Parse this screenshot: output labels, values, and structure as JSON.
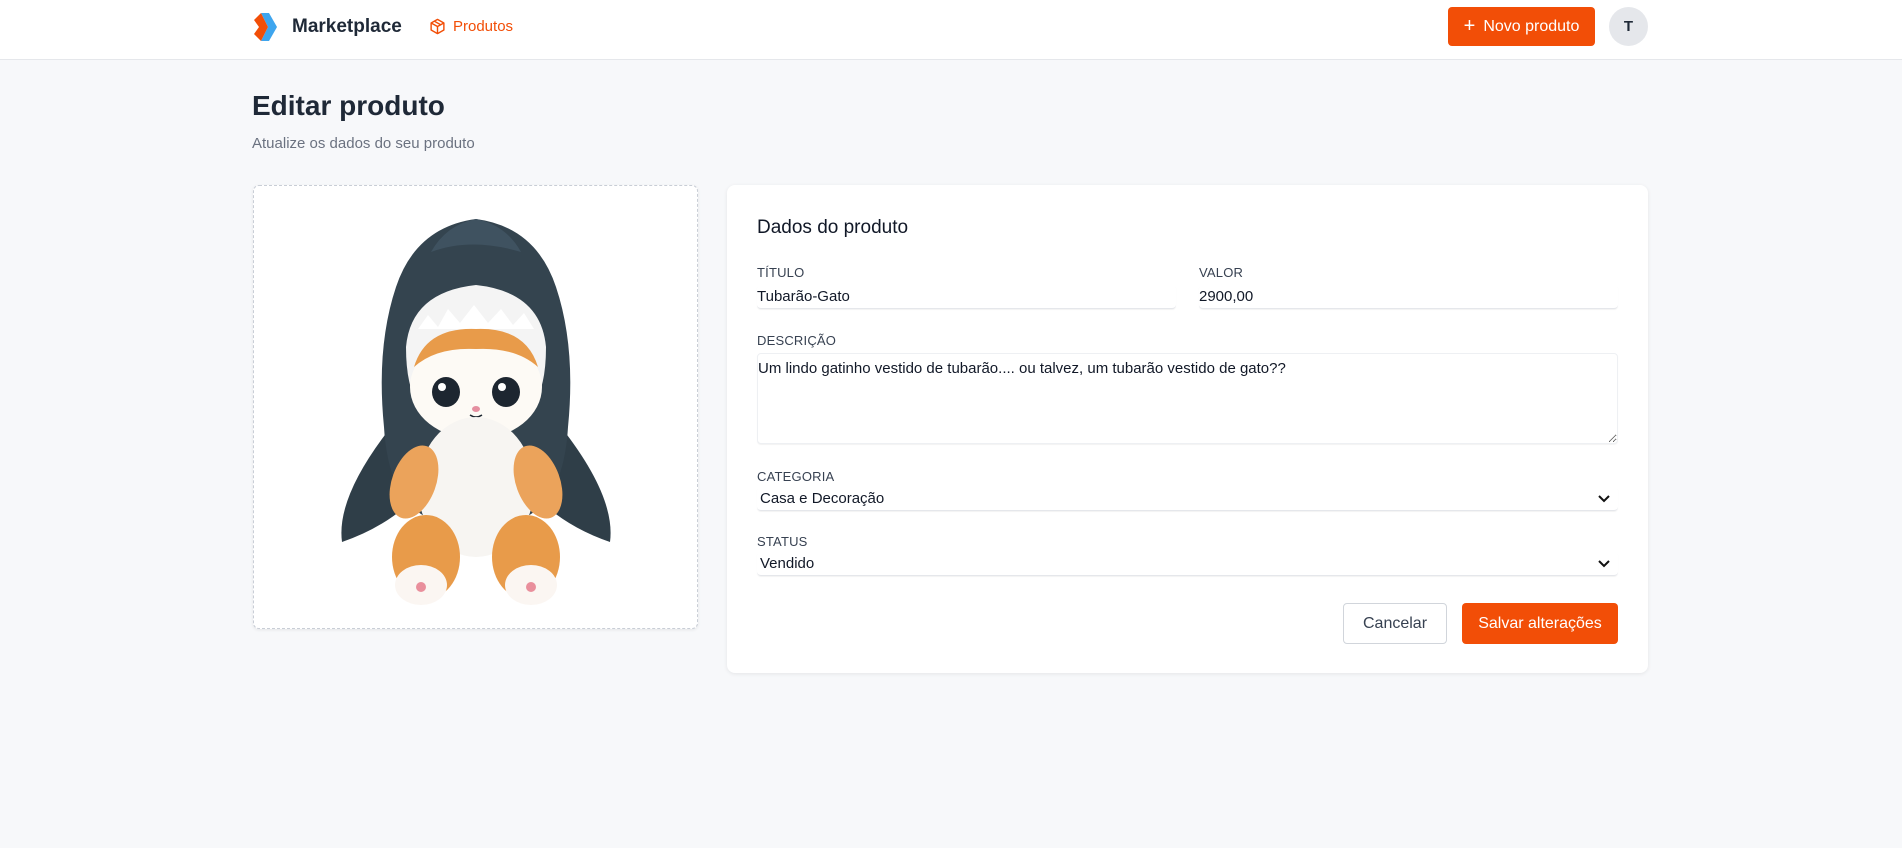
{
  "header": {
    "brand": "Marketplace",
    "nav_products": "Produtos",
    "new_product_button": "Novo produto",
    "avatar_initial": "T",
    "accent_color": "#f24e07"
  },
  "page": {
    "title": "Editar produto",
    "subtitle": "Atualize os dados do seu produto"
  },
  "image": {
    "icon": "product-photo-shark-cat-plush"
  },
  "form": {
    "card_title": "Dados do produto",
    "title_label": "TÍTULO",
    "title_value": "Tubarão-Gato",
    "price_label": "VALOR",
    "price_value": "2900,00",
    "description_label": "DESCRIÇÃO",
    "description_value": "Um lindo gatinho vestido de tubarão.... ou talvez, um tubarão vestido de gato??",
    "category_label": "CATEGORIA",
    "category_value": "Casa e Decoração",
    "status_label": "STATUS",
    "status_value": "Vendido",
    "cancel_button": "Cancelar",
    "save_button": "Salvar alterações"
  }
}
